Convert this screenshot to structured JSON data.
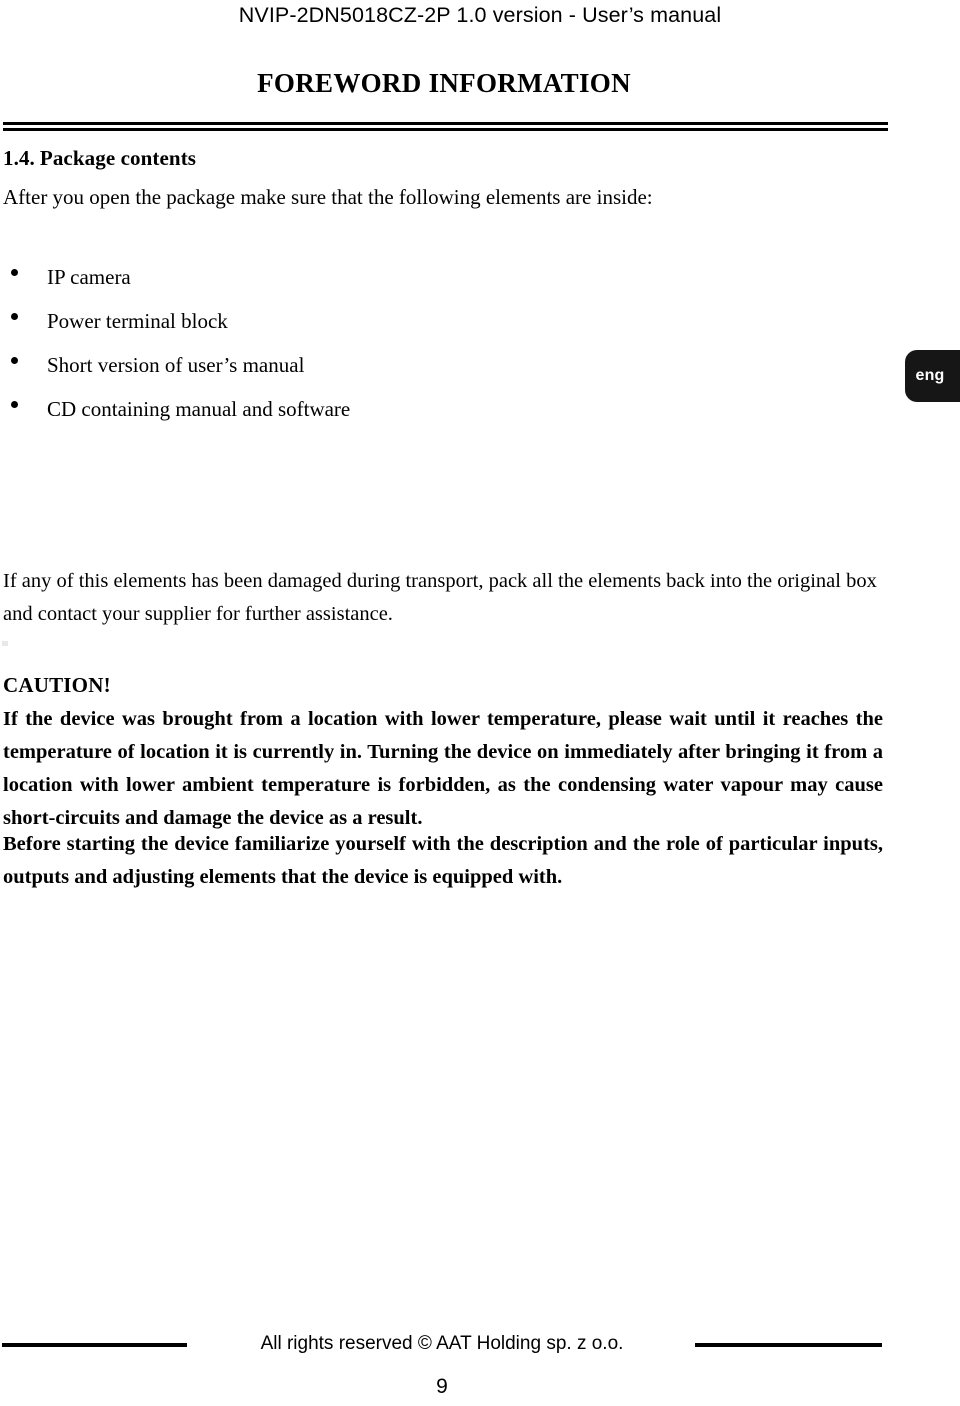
{
  "document": {
    "running_header": "NVIP-2DN5018CZ-2P 1.0 version - User’s manual",
    "chapter_title": "FOREWORD INFORMATION",
    "side_tab_label": "eng"
  },
  "section": {
    "number": "1.4.",
    "heading": "Package contents",
    "intro": "After you open the package make sure that the following elements are inside:",
    "items": [
      {
        "label": "IP camera"
      },
      {
        "label": "Power terminal block"
      },
      {
        "label": "Short version of user’s manual"
      },
      {
        "label": "CD containing manual and software"
      }
    ]
  },
  "notes": {
    "damaged_paragraph": "If any of this elements has been damaged during transport, pack all the elements back into the original box and contact your supplier for further assistance.",
    "caution_label": "CAUTION!",
    "caution_paragraph": "If the device was brought from a location with lower temperature, please wait until it reaches the temperature of location it is currently in. Turning the device on immediately after bringing it from a location with lower ambient temperature is forbidden, as the condensing water vapour may cause short-circuits and damage the device as a result.",
    "familiarize_paragraph": "Before starting the device familiarize yourself with the description and the role of particular inputs, outputs and adjusting elements that the device is equipped with."
  },
  "footer": {
    "copyright": "All rights reserved © AAT Holding sp. z o.o.",
    "page_number": "9"
  }
}
